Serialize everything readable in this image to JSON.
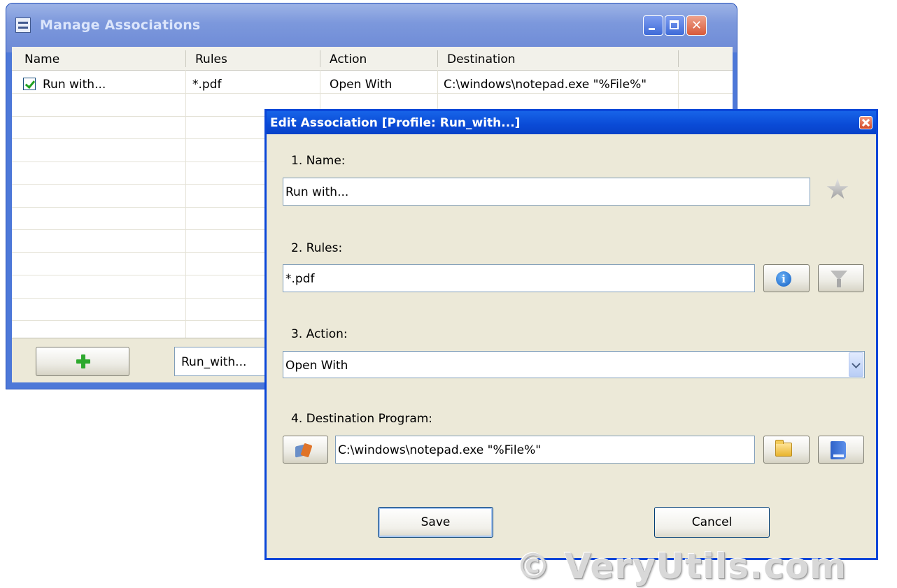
{
  "main_window": {
    "title": "Manage Associations",
    "columns": [
      "Name",
      "Rules",
      "Action",
      "Destination"
    ],
    "rows": [
      {
        "checked": true,
        "name": "Run with...",
        "rules": "*.pdf",
        "action": "Open With",
        "destination": "C:\\windows\\notepad.exe \"%File%\""
      }
    ],
    "profile_value": "Run_with..."
  },
  "dialog": {
    "title": "Edit Association [Profile: Run_with...]",
    "name_label": "1. Name:",
    "name_value": "Run with...",
    "rules_label": "2. Rules:",
    "rules_value": "*.pdf",
    "action_label": "3. Action:",
    "action_value": "Open With",
    "destination_label": "4. Destination Program:",
    "destination_value": "C:\\windows\\notepad.exe \"%File%\"",
    "save_label": "Save",
    "cancel_label": "Cancel"
  },
  "watermark": "© VeryUtils.com"
}
